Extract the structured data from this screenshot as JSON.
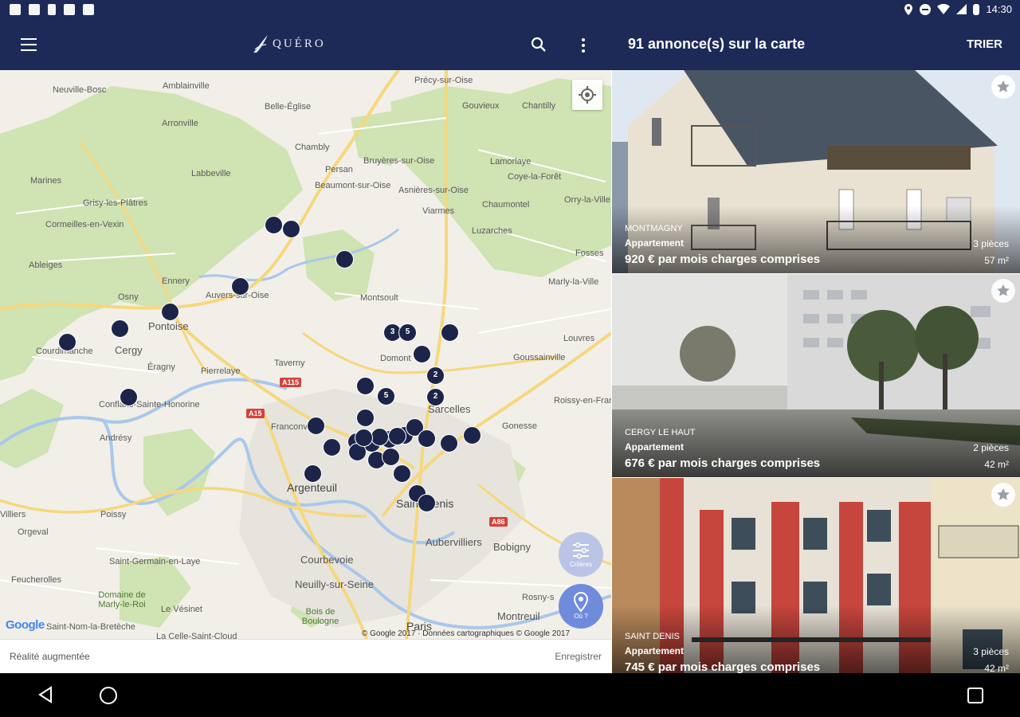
{
  "status_bar": {
    "time": "14:30",
    "left_icons": [
      "screenshot-icon",
      "photo-icon",
      "phone-icon",
      "sd-card-icon",
      "gallery-icon"
    ],
    "right_icons": [
      "location-icon",
      "do-not-disturb-icon",
      "wifi-icon",
      "signal-icon",
      "battery-icon"
    ]
  },
  "app_bar": {
    "logo_text": "QUÉRO",
    "results_title": "91 annonce(s) sur la carte",
    "sort_label": "TRIER"
  },
  "map": {
    "places": [
      {
        "name": "Amblainville",
        "cls": ""
      },
      {
        "name": "Neuville-Bosc",
        "cls": ""
      },
      {
        "name": "Précy-sur-Oise",
        "cls": ""
      },
      {
        "name": "Belle-Église",
        "cls": ""
      },
      {
        "name": "Gouvieux",
        "cls": ""
      },
      {
        "name": "Chantilly",
        "cls": ""
      },
      {
        "name": "Arronville",
        "cls": ""
      },
      {
        "name": "Chambly",
        "cls": ""
      },
      {
        "name": "Persan",
        "cls": ""
      },
      {
        "name": "Bruyères-sur-Oise",
        "cls": ""
      },
      {
        "name": "Lamorlaye",
        "cls": ""
      },
      {
        "name": "Marines",
        "cls": ""
      },
      {
        "name": "Labbeville",
        "cls": ""
      },
      {
        "name": "Beaumont-sur-Oise",
        "cls": ""
      },
      {
        "name": "Asnières-sur-Oise",
        "cls": ""
      },
      {
        "name": "Coye-la-Forêt",
        "cls": ""
      },
      {
        "name": "Grisy-les-Plâtres",
        "cls": ""
      },
      {
        "name": "Viarmes",
        "cls": ""
      },
      {
        "name": "Chaumontel",
        "cls": ""
      },
      {
        "name": "Orry-la-Ville",
        "cls": ""
      },
      {
        "name": "Cormeilles-en-Vexin",
        "cls": ""
      },
      {
        "name": "Luzarches",
        "cls": ""
      },
      {
        "name": "Ableiges",
        "cls": ""
      },
      {
        "name": "Ennery",
        "cls": ""
      },
      {
        "name": "Fosses",
        "cls": ""
      },
      {
        "name": "Auvers-sur-Oise",
        "cls": ""
      },
      {
        "name": "Marly-la-Ville",
        "cls": ""
      },
      {
        "name": "Osny",
        "cls": ""
      },
      {
        "name": "Montsoult",
        "cls": ""
      },
      {
        "name": "Pontoise",
        "cls": "med"
      },
      {
        "name": "Cergy",
        "cls": "med"
      },
      {
        "name": "Courdimanche",
        "cls": ""
      },
      {
        "name": "Louvres",
        "cls": ""
      },
      {
        "name": "Domont",
        "cls": ""
      },
      {
        "name": "Éragny",
        "cls": ""
      },
      {
        "name": "Taverny",
        "cls": ""
      },
      {
        "name": "Pierrelaye",
        "cls": ""
      },
      {
        "name": "Goussainville",
        "cls": ""
      },
      {
        "name": "Sarcelles",
        "cls": "med"
      },
      {
        "name": "Conflans-Sainte-Honorine",
        "cls": ""
      },
      {
        "name": "Roissy-en-France",
        "cls": ""
      },
      {
        "name": "Franconville",
        "cls": ""
      },
      {
        "name": "Andrésy",
        "cls": ""
      },
      {
        "name": "Gonesse",
        "cls": ""
      },
      {
        "name": "Argenteuil",
        "cls": "big"
      },
      {
        "name": "Saint-Denis",
        "cls": "big"
      },
      {
        "name": "Poissy",
        "cls": ""
      },
      {
        "name": "Villiers",
        "cls": ""
      },
      {
        "name": "Orgeval",
        "cls": ""
      },
      {
        "name": "Aubervilliers",
        "cls": "med"
      },
      {
        "name": "Bobigny",
        "cls": "med"
      },
      {
        "name": "Courbevoie",
        "cls": "med"
      },
      {
        "name": "Saint-Germain-en-Laye",
        "cls": ""
      },
      {
        "name": "Neuilly-sur-Seine",
        "cls": "med"
      },
      {
        "name": "Feucherolles",
        "cls": ""
      },
      {
        "name": "Domaine de Marly-le-Roi",
        "cls": ""
      },
      {
        "name": "Le Vésinet",
        "cls": ""
      },
      {
        "name": "Bois de Boulogne",
        "cls": ""
      },
      {
        "name": "Rosny-s",
        "cls": ""
      },
      {
        "name": "Montreuil",
        "cls": "med"
      },
      {
        "name": "Paris",
        "cls": "big"
      },
      {
        "name": "Saint-Nom-la-Bretèche",
        "cls": ""
      },
      {
        "name": "La Celle-Saint-Cloud",
        "cls": ""
      }
    ],
    "road_badges": [
      "A115",
      "A15",
      "A86"
    ],
    "markers": [
      {
        "label": ""
      },
      {
        "label": ""
      },
      {
        "label": ""
      },
      {
        "label": ""
      },
      {
        "label": ""
      },
      {
        "label": ""
      },
      {
        "label": ""
      },
      {
        "label": ""
      },
      {
        "label": "3"
      },
      {
        "label": "5"
      },
      {
        "label": ""
      },
      {
        "label": ""
      },
      {
        "label": "2"
      },
      {
        "label": "2"
      },
      {
        "label": ""
      },
      {
        "label": "5"
      },
      {
        "label": ""
      },
      {
        "label": ""
      },
      {
        "label": ""
      },
      {
        "label": ""
      },
      {
        "label": ""
      },
      {
        "label": ""
      },
      {
        "label": ""
      },
      {
        "label": ""
      },
      {
        "label": ""
      },
      {
        "label": ""
      },
      {
        "label": ""
      },
      {
        "label": ""
      },
      {
        "label": ""
      },
      {
        "label": ""
      },
      {
        "label": ""
      },
      {
        "label": ""
      },
      {
        "label": ""
      },
      {
        "label": ""
      },
      {
        "label": ""
      },
      {
        "label": ""
      },
      {
        "label": ""
      }
    ],
    "criteria_label": "Critères",
    "where_label": "Où ?",
    "google_logo": "Google",
    "copyright": "© Google 2017 · Données cartographiques © Google 2017",
    "ar_label": "Réalité augmentée",
    "save_label": "Enregistrer"
  },
  "listings": [
    {
      "city": "MONTMAGNY",
      "type": "Appartement",
      "price": "920 € par mois charges comprises",
      "rooms": "3 pièces",
      "area": "57 m²"
    },
    {
      "city": "CERGY LE HAUT",
      "type": "Appartement",
      "price": "676 € par mois charges comprises",
      "rooms": "2 pièces",
      "area": "42 m²"
    },
    {
      "city": "SAINT DENIS",
      "type": "Appartement",
      "price": "745 € par mois charges comprises",
      "rooms": "3 pièces",
      "area": "42 m²"
    }
  ],
  "colors": {
    "brand_navy": "#1d2a57",
    "marker": "#1c2549",
    "map_green": "#cfe3b3",
    "road_yellow": "#f7d77d"
  }
}
